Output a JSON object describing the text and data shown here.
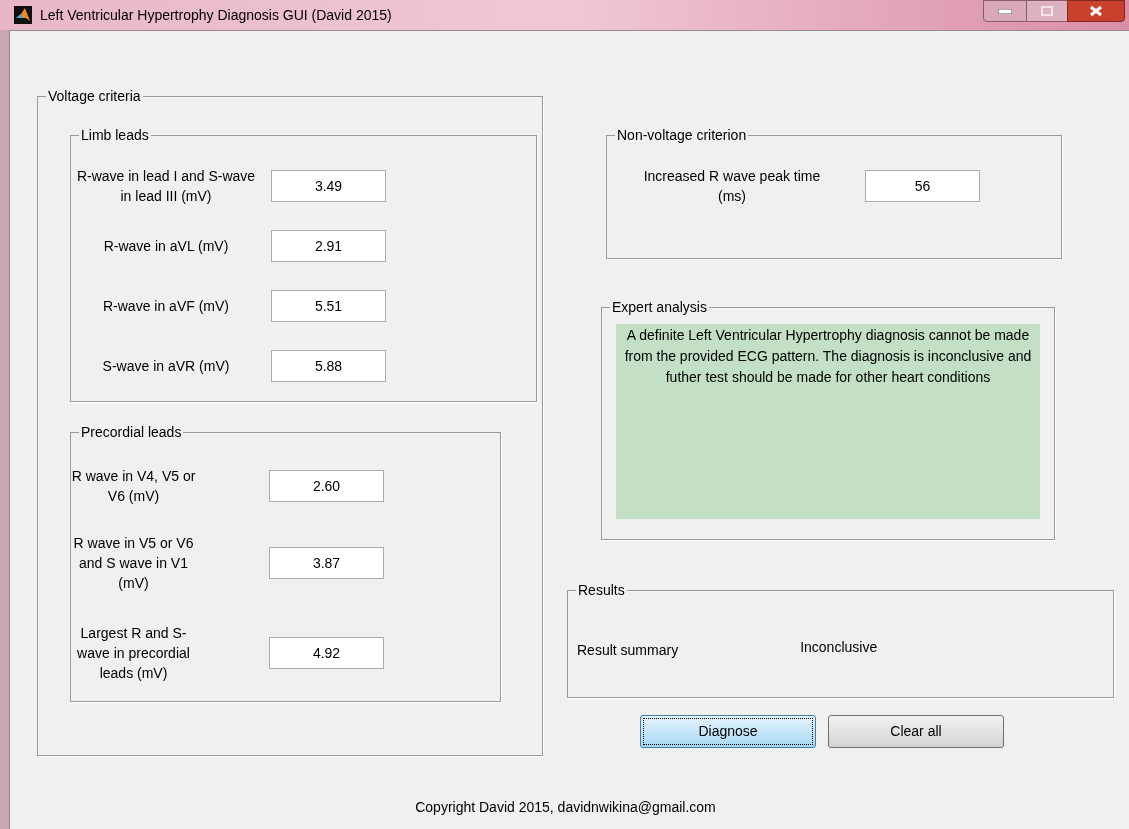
{
  "window": {
    "title": "Left Ventricular Hypertrophy Diagnosis GUI (David 2015)"
  },
  "voltage_criteria": {
    "title": "Voltage criteria",
    "limb_leads": {
      "title": "Limb leads",
      "fields": [
        {
          "label": "R-wave in lead I and S-wave in lead III (mV)",
          "value": "3.49"
        },
        {
          "label": "R-wave in aVL (mV)",
          "value": "2.91"
        },
        {
          "label": "R-wave in aVF (mV)",
          "value": "5.51"
        },
        {
          "label": "S-wave in aVR (mV)",
          "value": "5.88"
        }
      ]
    },
    "precordial_leads": {
      "title": "Precordial leads",
      "fields": [
        {
          "label": "R wave in V4, V5 or V6 (mV)",
          "value": "2.60"
        },
        {
          "label": "R wave in V5 or V6 and S wave in V1 (mV)",
          "value": "3.87"
        },
        {
          "label": "Largest R and S-wave in precordial leads (mV)",
          "value": "4.92"
        }
      ]
    }
  },
  "non_voltage_criterion": {
    "title": "Non-voltage criterion",
    "label": "Increased R wave peak time (ms)",
    "value": "56"
  },
  "expert_analysis": {
    "title": "Expert analysis",
    "text": "A definite Left Ventricular Hypertrophy diagnosis cannot be made from the provided ECG pattern. The diagnosis is inconclusive and futher test should be made for other heart conditions"
  },
  "results": {
    "title": "Results",
    "label": "Result summary",
    "value": "Inconclusive"
  },
  "buttons": [
    {
      "label": "Diagnose",
      "focused": true
    },
    {
      "label": "Clear all",
      "focused": false
    }
  ],
  "footer": "Copyright David 2015, davidnwikina@gmail.com"
}
